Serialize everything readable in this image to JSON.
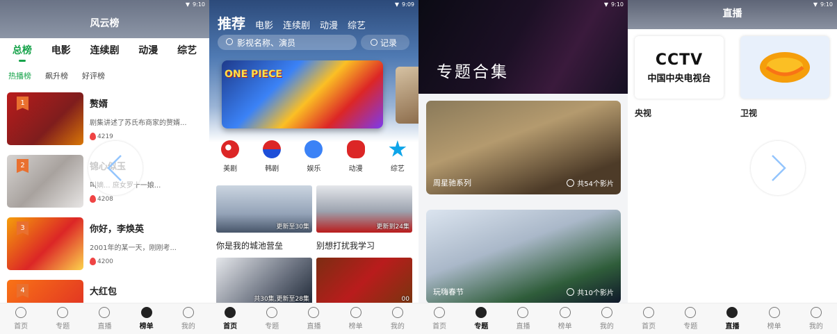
{
  "status": {
    "time": "9:10",
    "time_p2": "9:09"
  },
  "nav": {
    "home": "首页",
    "topic": "专题",
    "live": "直播",
    "rank": "榜单",
    "mine": "我的"
  },
  "ranking": {
    "title": "风云榜",
    "tabs": [
      "总榜",
      "电影",
      "连续剧",
      "动漫",
      "综艺"
    ],
    "subtabs": [
      "热播榜",
      "飙升榜",
      "好评榜"
    ],
    "items": [
      {
        "rank": "1",
        "title": "赘婿",
        "desc": "剧集讲述了苏氏布商家的赘婿...",
        "heat": "4219"
      },
      {
        "rank": "2",
        "title": "锦心似玉",
        "desc": "叫嫡... 庶女罗十一娘...",
        "heat": "4208"
      },
      {
        "rank": "3",
        "title": "你好，李焕英",
        "desc": "2001年的某一天，刚刚考...",
        "heat": "4200"
      },
      {
        "rank": "4",
        "title": "大红包",
        "desc": "",
        "heat": ""
      }
    ]
  },
  "home": {
    "tabs": [
      "推荐",
      "电影",
      "连续剧",
      "动漫",
      "综艺"
    ],
    "search_placeholder": "影视名称、演员",
    "history": "记录",
    "banner_logo": "ONE PIECE",
    "categories": [
      {
        "label": "美剧",
        "icon": "us-flag-icon",
        "color": "#dc2626"
      },
      {
        "label": "韩剧",
        "icon": "korea-icon",
        "color": "#1d4ed8"
      },
      {
        "label": "娱乐",
        "icon": "gamepad-icon",
        "color": "#3b82f6"
      },
      {
        "label": "动漫",
        "icon": "flower-icon",
        "color": "#dc2626"
      },
      {
        "label": "综艺",
        "icon": "star-icon",
        "color": "#0ea5e9"
      }
    ],
    "cards": [
      {
        "title": "你是我的城池营垒",
        "update": "更新至30集"
      },
      {
        "title": "别想打扰我学习",
        "update": "更新到24集"
      },
      {
        "title": "",
        "update": "共30集,更新至28集"
      },
      {
        "title": "",
        "update": "00"
      }
    ]
  },
  "topics": {
    "title": "专题合集",
    "cards": [
      {
        "name": "周星驰系列",
        "count": "共54个影片"
      },
      {
        "name": "玩嗨春节",
        "count": "共10个影片"
      }
    ]
  },
  "live": {
    "title": "直播",
    "tiles": [
      {
        "label": "央视",
        "logo_en": "CCTV",
        "logo_cn": "中国中央电视台"
      },
      {
        "label": "卫视"
      }
    ]
  }
}
